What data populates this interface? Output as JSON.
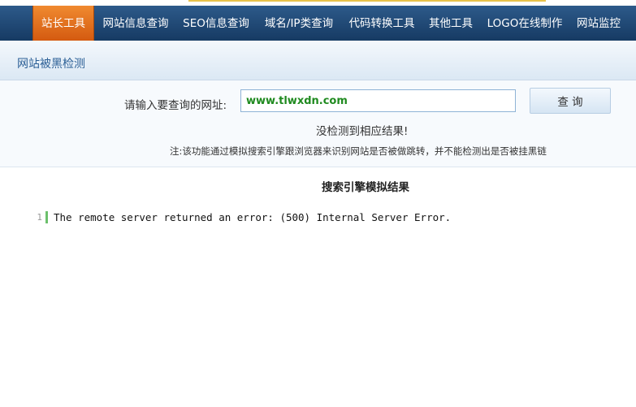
{
  "nav": {
    "items": [
      {
        "label": "站长工具",
        "active": true
      },
      {
        "label": "网站信息查询"
      },
      {
        "label": "SEO信息查询"
      },
      {
        "label": "域名/IP类查询"
      },
      {
        "label": "代码转换工具"
      },
      {
        "label": "其他工具"
      },
      {
        "label": "LOGO在线制作"
      },
      {
        "label": "网站监控"
      }
    ]
  },
  "page": {
    "title": "网站被黑检测"
  },
  "form": {
    "url_label": "请输入要查询的网址:",
    "url_value": "www.tlwxdn.com",
    "submit_label": "查 询",
    "result_message": "没检测到相应结果!",
    "note": "注:该功能通过模拟搜索引擎跟浏览器来识别网站是否被做跳转，并不能检测出是否被挂黑链"
  },
  "results": {
    "title": "搜索引擎模拟结果",
    "lines": [
      {
        "number": "1",
        "text": "The remote server returned an error: (500) Internal Server Error."
      }
    ]
  },
  "colors": {
    "nav_bg": "#1f4a78",
    "nav_active": "#e8731f",
    "title_text": "#2b5f96",
    "url_text": "#1f8a1f",
    "code_marker": "#6cc06c"
  }
}
